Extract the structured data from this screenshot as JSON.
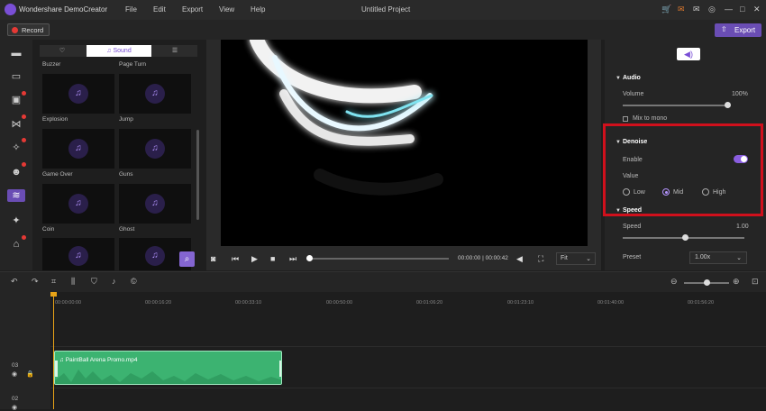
{
  "app": {
    "title": "Wondershare DemoCreator",
    "project_title": "Untitled Project"
  },
  "menu": [
    "File",
    "Edit",
    "Export",
    "View",
    "Help"
  ],
  "toolbar": {
    "record_label": "Record",
    "export_label": "Export"
  },
  "library": {
    "tabs": [
      {
        "icon": "heart-icon"
      },
      {
        "label": "Sound"
      },
      {
        "icon": "list-icon"
      }
    ],
    "row_labels": [
      [
        "Buzzer",
        "Page Turn"
      ],
      [
        "Explosion",
        "Jump"
      ],
      [
        "Game Over",
        "Guns"
      ],
      [
        "Coin",
        "Ghost"
      ]
    ]
  },
  "player": {
    "timecode": "00:00:00 | 00:00:42",
    "fit": "Fit"
  },
  "properties": {
    "audio": {
      "title": "Audio",
      "volume_label": "Volume",
      "volume_value": "100%",
      "volume_level": 1.0,
      "mix_label": "Mix to mono"
    },
    "denoise": {
      "title": "Denoise",
      "enable_label": "Enable",
      "value_label": "Value",
      "options": [
        "Low",
        "Mid",
        "High"
      ],
      "selected": "Mid"
    },
    "speed": {
      "title": "Speed",
      "speed_label": "Speed",
      "speed_value": "1.00",
      "preset_label": "Preset",
      "preset_value": "1.00x"
    }
  },
  "timeline": {
    "ticks": [
      "00:00:00:00",
      "00:00:16:20",
      "00:00:33:10",
      "00:00:50:00",
      "00:01:06:20",
      "00:01:23:10",
      "00:01:40:00",
      "00:01:56:20"
    ],
    "tracks": [
      "03",
      "02"
    ],
    "clip_name": "PaintBall Arena Promo.mp4"
  },
  "colors": {
    "accent": "#6a4db4",
    "clip": "#3cb371",
    "highlight": "#d0101c",
    "playhead": "#e8a317"
  }
}
